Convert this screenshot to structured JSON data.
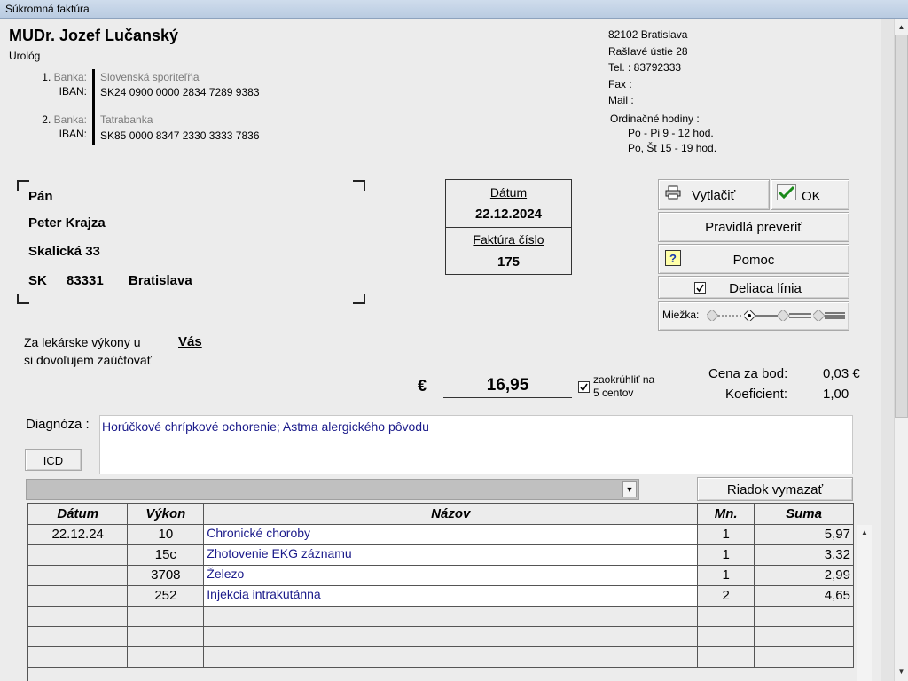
{
  "window": {
    "title": "Súkromná faktúra"
  },
  "doctor": {
    "name": "MUDr. Jozef Lučanský",
    "specialty": "Urológ",
    "banks": [
      {
        "index": "1.",
        "bank_label": "Banka:",
        "bank_name": "Slovenská sporiteľňa",
        "iban_label": "IBAN:",
        "iban": "SK24 0900 0000 2834 7289 9383"
      },
      {
        "index": "2.",
        "bank_label": "Banka:",
        "bank_name": "Tatrabanka",
        "iban_label": "IBAN:",
        "iban": "SK85 0000 8347 2330 3333 7836"
      }
    ],
    "address": {
      "city_line": "82102  Bratislava",
      "street": "Rašľavé ústie 28",
      "tel": "Tel. :   83792333",
      "fax": "Fax :",
      "mail": "Mail :",
      "hours_title": "Ordinačné hodiny :",
      "hours_1": "Po - Pi  9 - 12 hod.",
      "hours_2": "Po, Št  15 - 19 hod."
    }
  },
  "recipient": {
    "salutation": "Pán",
    "name": "Peter Krajza",
    "street": "Skalická 33",
    "country": "SK",
    "zip": "83331",
    "city": "Bratislava"
  },
  "date_box": {
    "date_label": "Dátum",
    "date_value": "22.12.2024",
    "invoice_label": "Faktúra číslo",
    "invoice_value": "175"
  },
  "buttons": {
    "print": "Vytlačiť",
    "ok": "OK",
    "check_rules": "Pravidlá preveriť",
    "help": "Pomoc",
    "divider_line": "Deliaca línia",
    "divider_checked": true,
    "grid_label": "Miežka:",
    "icd": "ICD",
    "delete_row": "Riadok vymazať"
  },
  "text": {
    "services_line1": "Za lekárske výkony u",
    "services_line2": "si dovoľujem zaúčtovať",
    "services_for": "Vás",
    "currency": "€",
    "amount": "16,95",
    "round_label_1": "zaokrúhliť na",
    "round_label_2": "5 centov",
    "round_checked": true,
    "price_per_point_label": "Cena za bod:",
    "price_per_point_value": "0,03 €",
    "coefficient_label": "Koeficient:",
    "coefficient_value": "1,00",
    "diagnosis_label": "Diagnóza :",
    "diagnosis_value": "Horúčkové chrípkové ochorenie; Astma alergického pôvodu"
  },
  "table": {
    "headers": [
      "Dátum",
      "Výkon",
      "Názov",
      "Mn.",
      "Suma"
    ],
    "rows": [
      {
        "date": "22.12.24",
        "code": "10",
        "name": "Chronické choroby",
        "qty": "1",
        "sum": "5,97"
      },
      {
        "date": "",
        "code": "15c",
        "name": "Zhotovenie EKG záznamu",
        "qty": "1",
        "sum": "3,32"
      },
      {
        "date": "",
        "code": "3708",
        "name": "Železo",
        "qty": "1",
        "sum": "2,99"
      },
      {
        "date": "",
        "code": "252",
        "name": "Injekcia intrakutánna",
        "qty": "2",
        "sum": "4,65"
      }
    ]
  },
  "icons": [
    "printer-icon",
    "checkmark-icon",
    "help-icon",
    "checkbox-icon",
    "dropdown-arrow-icon",
    "scroll-up-icon",
    "scroll-down-icon"
  ]
}
